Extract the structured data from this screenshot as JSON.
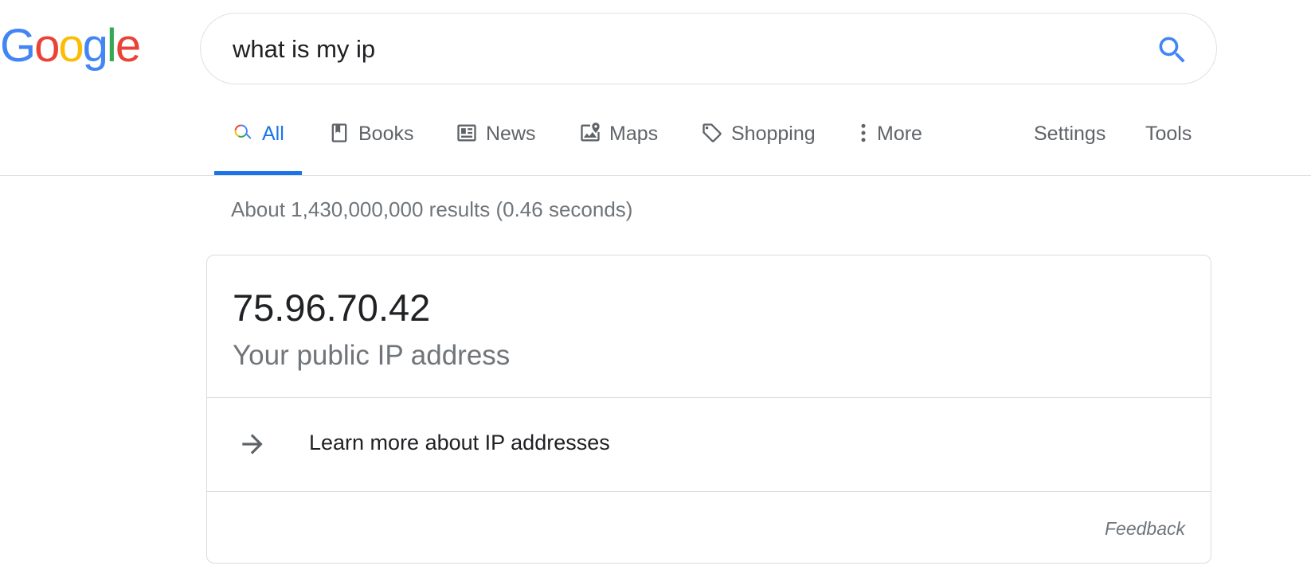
{
  "logo": {
    "letters": [
      "G",
      "o",
      "o",
      "g",
      "l",
      "e"
    ],
    "colors": [
      "#4285F4",
      "#EA4335",
      "#FBBC05",
      "#4285F4",
      "#34A853",
      "#EA4335"
    ]
  },
  "search": {
    "query": "what is my ip",
    "icon": "search-icon",
    "icon_color": "#4285F4"
  },
  "tabs": [
    {
      "label": "All",
      "icon": "all-search-icon",
      "active": true
    },
    {
      "label": "Books",
      "icon": "book-icon",
      "active": false
    },
    {
      "label": "News",
      "icon": "news-icon",
      "active": false
    },
    {
      "label": "Maps",
      "icon": "map-icon",
      "active": false
    },
    {
      "label": "Shopping",
      "icon": "tag-icon",
      "active": false
    },
    {
      "label": "More",
      "icon": "more-vert-icon",
      "active": false
    }
  ],
  "tools": {
    "settings_label": "Settings",
    "tools_label": "Tools"
  },
  "result_stats": "About 1,430,000,000 results (0.46 seconds)",
  "ip_card": {
    "ip": "75.96.70.42",
    "subtitle": "Your public IP address",
    "learn_more": "Learn more about IP addresses",
    "feedback": "Feedback"
  },
  "colors": {
    "accent": "#1a73e8",
    "muted_text": "#70757a",
    "border": "#dadce0"
  }
}
